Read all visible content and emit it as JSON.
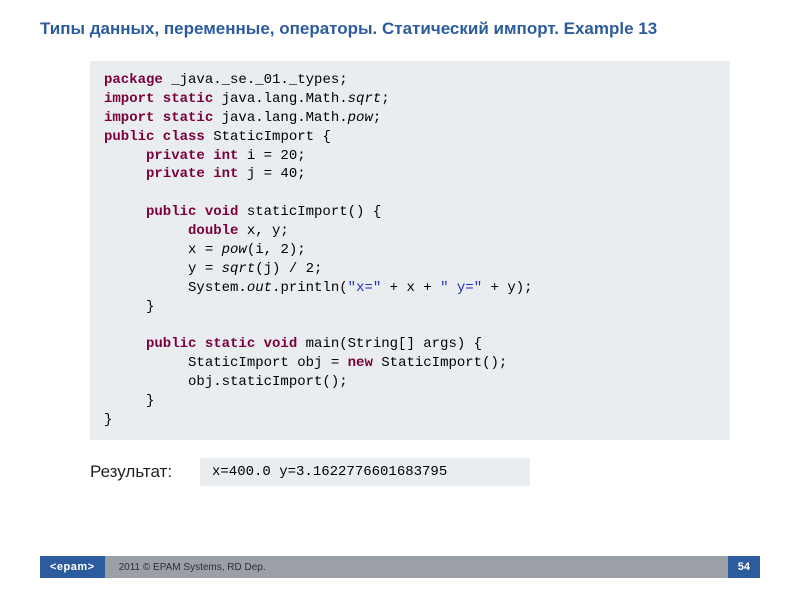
{
  "title": "Типы данных, переменные, операторы. Статический импорт. Example 13",
  "code": {
    "l1a": "package",
    "l1b": " _java._se._01._types;",
    "l2a": "import static",
    "l2b": " java.lang.Math.",
    "l2c": "sqrt",
    "l2d": ";",
    "l3a": "import static",
    "l3b": " java.lang.Math.",
    "l3c": "pow",
    "l3d": ";",
    "l4a": "public class",
    "l4b": " StaticImport {",
    "l5a": "     private int",
    "l5b": " i = 20;",
    "l6a": "     private int",
    "l6b": " j = 40;",
    "l8a": "     public void",
    "l8b": " staticImport() {",
    "l9a": "          double",
    "l9b": " x, y;",
    "l10a": "          x = ",
    "l10b": "pow",
    "l10c": "(i, 2);",
    "l11a": "          y = ",
    "l11b": "sqrt",
    "l11c": "(j) / 2;",
    "l12a": "          System.",
    "l12b": "out",
    "l12c": ".println(",
    "l12d": "\"x=\"",
    "l12e": " + x + ",
    "l12f": "\" y=\"",
    "l12g": " + y);",
    "l13": "     }",
    "l15a": "     public static void",
    "l15b": " main(String[] args) {",
    "l16a": "          StaticImport obj = ",
    "l16b": "new",
    "l16c": " StaticImport();",
    "l17": "          obj.staticImport();",
    "l18": "     }",
    "l19": "}"
  },
  "result_label": "Результат:",
  "result_output": "x=400.0   y=3.1622776601683795",
  "footer": {
    "logo": "<epam>",
    "copyright": "2011 © EPAM Systems, RD Dep.",
    "page": "54"
  }
}
